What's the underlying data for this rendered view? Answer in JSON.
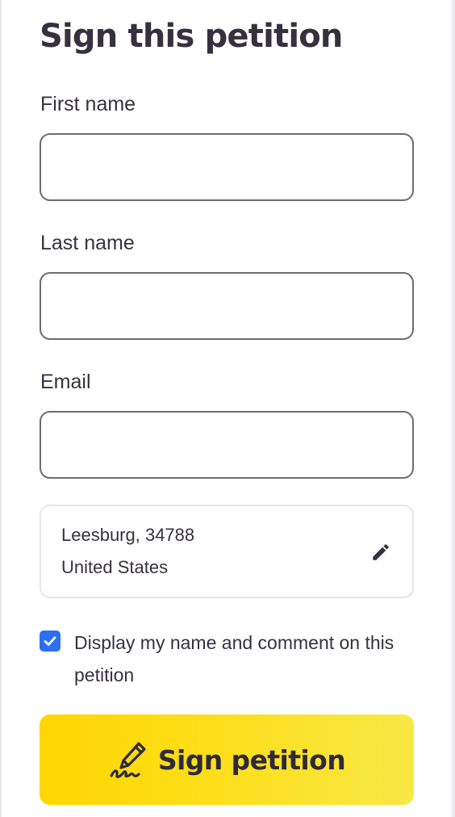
{
  "form": {
    "title": "Sign this petition",
    "first_name": {
      "label": "First name",
      "value": "",
      "placeholder": ""
    },
    "last_name": {
      "label": "Last name",
      "value": "",
      "placeholder": ""
    },
    "email": {
      "label": "Email",
      "value": "",
      "placeholder": ""
    },
    "location": {
      "line1": "Leesburg, 34788",
      "line2": "United States",
      "edit_icon": "pencil-icon"
    },
    "display_consent": {
      "checked": true,
      "label": "Display my name and comment on this petition"
    },
    "submit": {
      "label": "Sign petition",
      "icon": "signature-pen-icon"
    }
  },
  "colors": {
    "text": "#36313f",
    "input_border": "#6e6b77",
    "checkbox": "#2d6ff2",
    "button_gradient_start": "#ffd600",
    "button_gradient_end": "#f8e845"
  }
}
